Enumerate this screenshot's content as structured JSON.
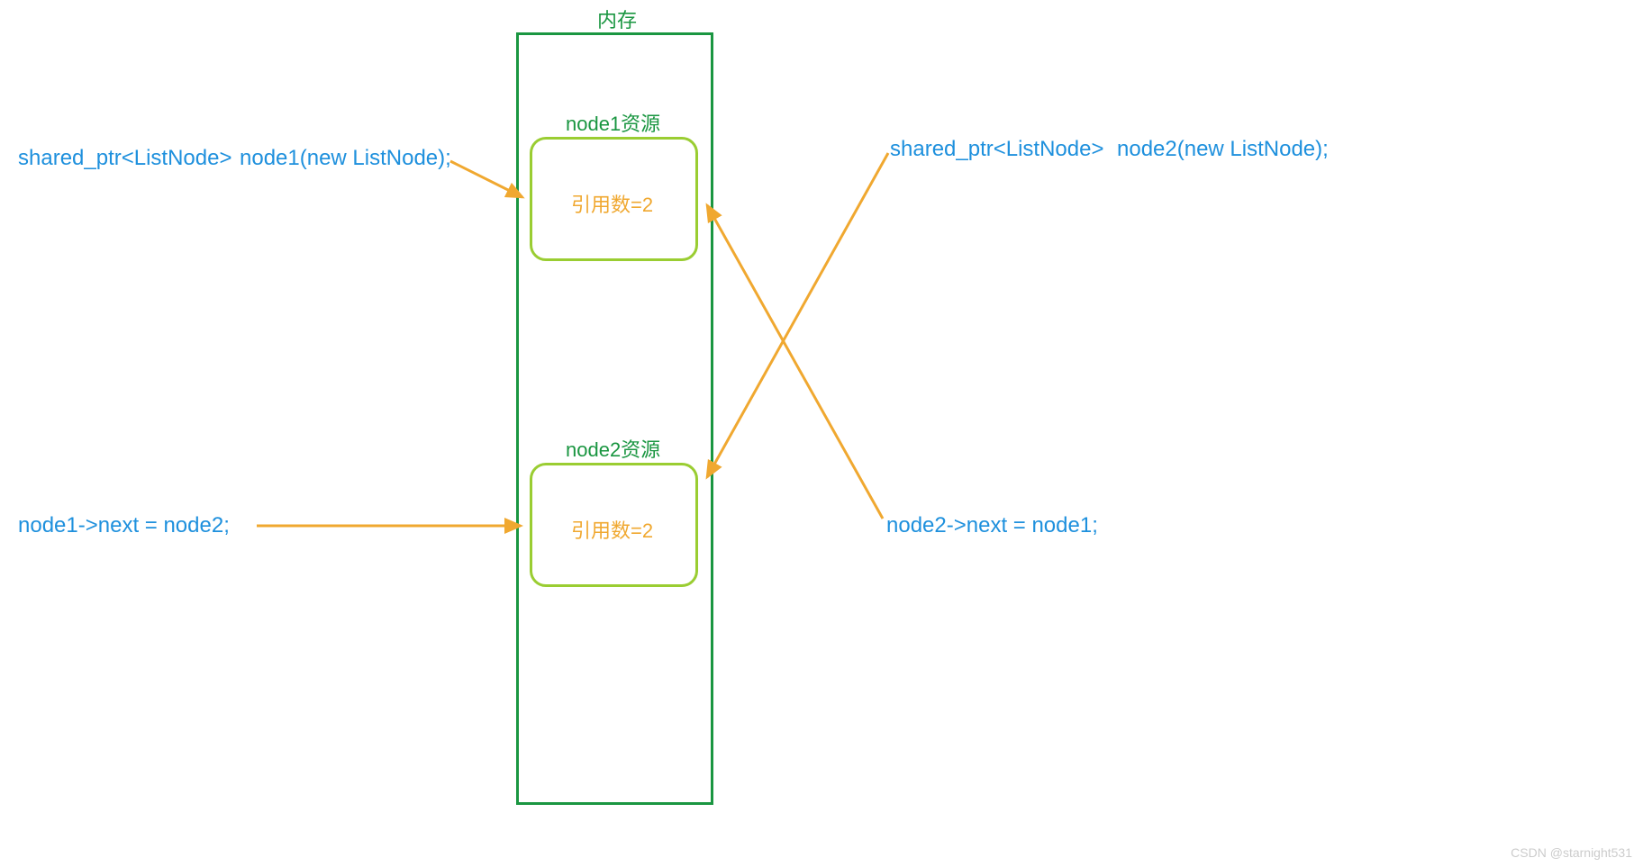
{
  "memory": {
    "title": "内存"
  },
  "node1": {
    "title": "node1资源",
    "refCount": "引用数=2"
  },
  "node2": {
    "title": "node2资源",
    "refCount": "引用数=2"
  },
  "labels": {
    "topLeft1": "shared_ptr<ListNode>",
    "topLeft2": "node1(new ListNode);",
    "bottomLeft": "node1->next = node2;",
    "topRight1": "shared_ptr<ListNode>",
    "topRight2": "node2(new ListNode);",
    "bottomRight": "node2->next = node1;"
  },
  "watermark": "CSDN @starnight531",
  "colors": {
    "green": "#1a9641",
    "lime": "#9acd32",
    "orange": "#f0a830",
    "blue": "#1e90dd",
    "arrowStroke": "#f0a830"
  }
}
